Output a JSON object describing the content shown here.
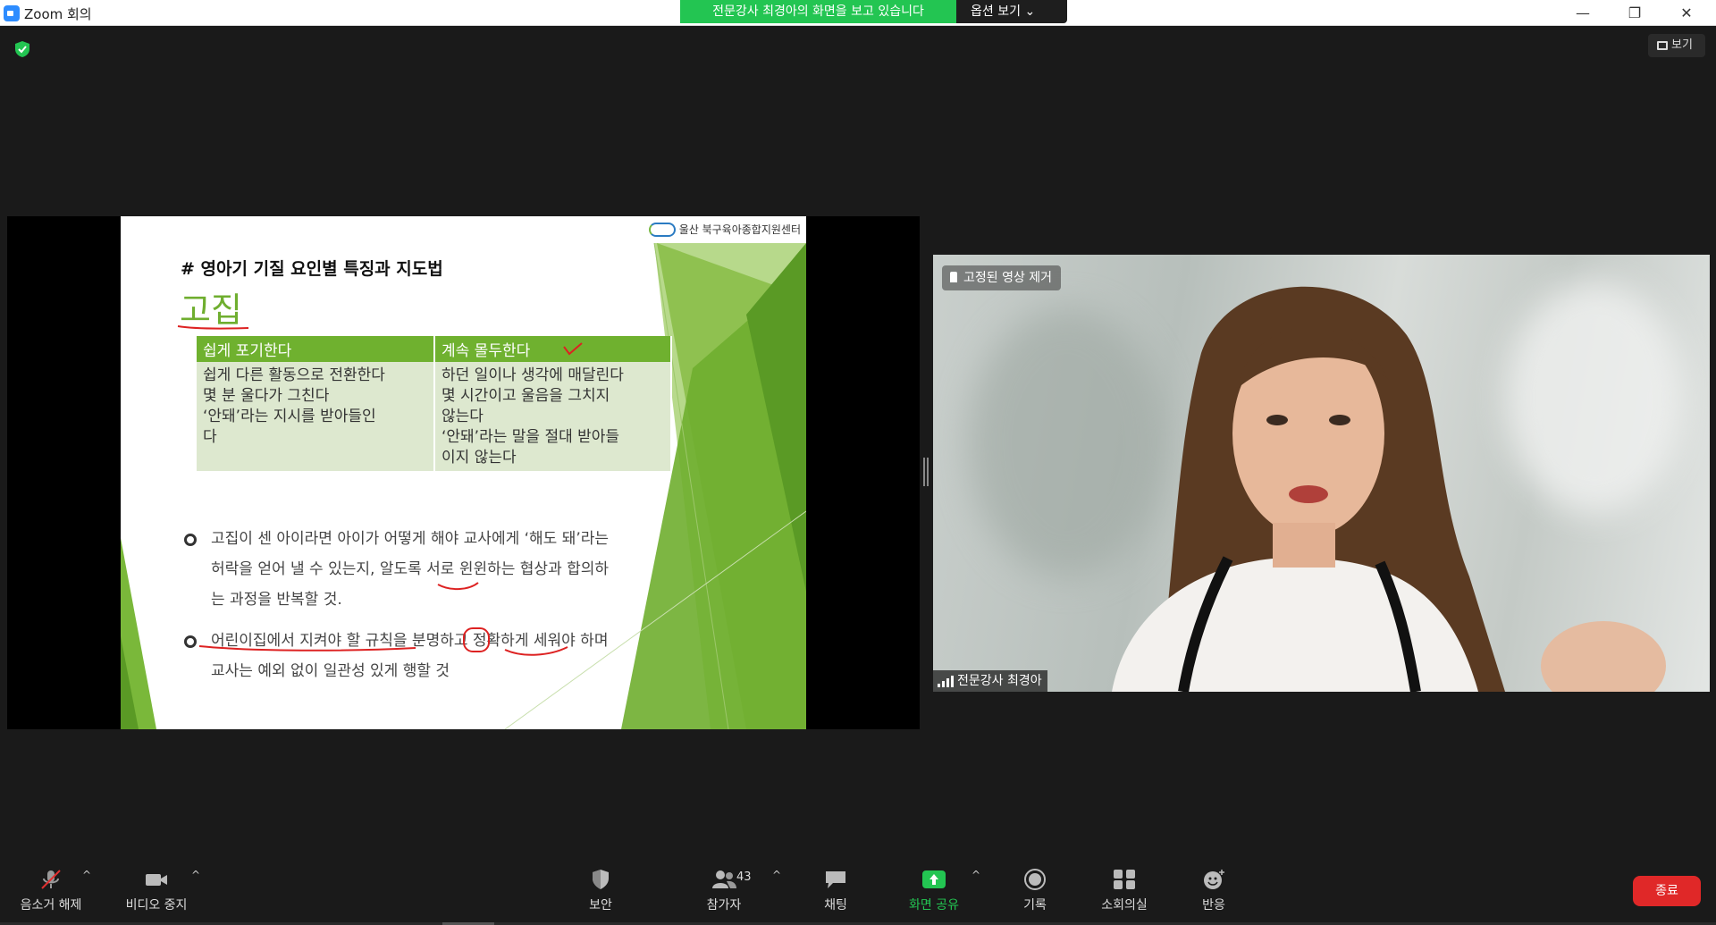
{
  "window": {
    "title": "Zoom 회의",
    "minimize": "—",
    "restore": "❐",
    "close": "✕"
  },
  "share_banner": {
    "text": "전문강사 최경아의 화면을 보고 있습니다",
    "options_label": "옵션 보기",
    "options_caret": "⌄"
  },
  "view_button": {
    "label": "보기"
  },
  "slide": {
    "logo_text": "울산 북구육아종합지원센터",
    "heading": "# 영아기 기질 요인별 특징과 지도법",
    "title": "고집",
    "table": {
      "headers": [
        "쉽게 포기한다",
        "계속 몰두한다"
      ],
      "col1_lines": [
        "쉽게 다른 활동으로 전환한다",
        "몇 분 울다가 그친다",
        "‘안돼’라는 지시를 받아들인",
        "다"
      ],
      "col2_lines": [
        "하던 일이나 생각에 매달린다",
        "몇 시간이고 울음을 그치지",
        "않는다",
        "‘안돼’라는 말을 절대 받아들",
        "이지 않는다"
      ]
    },
    "bullets": [
      {
        "lines": [
          "고집이 센 아이라면 아이가 어떻게 해야 교사에게 ‘해도 돼’라는",
          "허락을 얻어 낼 수 있는지, 알도록 서로 윈윈하는 협상과 합의하",
          "는 과정을 반복할 것."
        ]
      },
      {
        "lines": [
          "어린이집에서 지켜야 할 규칙을 분명하고 정확하게 세워야 하며",
          "교사는 예외 없이 일관성 있게 행할 것"
        ]
      }
    ]
  },
  "video": {
    "pin_label": "고정된 영상 제거",
    "participant_name": "전문강사 최경아"
  },
  "toolbar": {
    "mute_label": "음소거 해제",
    "video_label": "비디오 중지",
    "security_label": "보안",
    "participants_label": "참가자",
    "participants_count": "43",
    "chat_label": "채팅",
    "share_label": "화면 공유",
    "record_label": "기록",
    "breakout_label": "소회의실",
    "reactions_label": "반응",
    "end_label": "종료",
    "caret": "^"
  },
  "colors": {
    "share_green": "#23c552",
    "slide_green": "#6fb12f",
    "end_red": "#e02828",
    "toolbar_bg": "#1a1a1a"
  }
}
